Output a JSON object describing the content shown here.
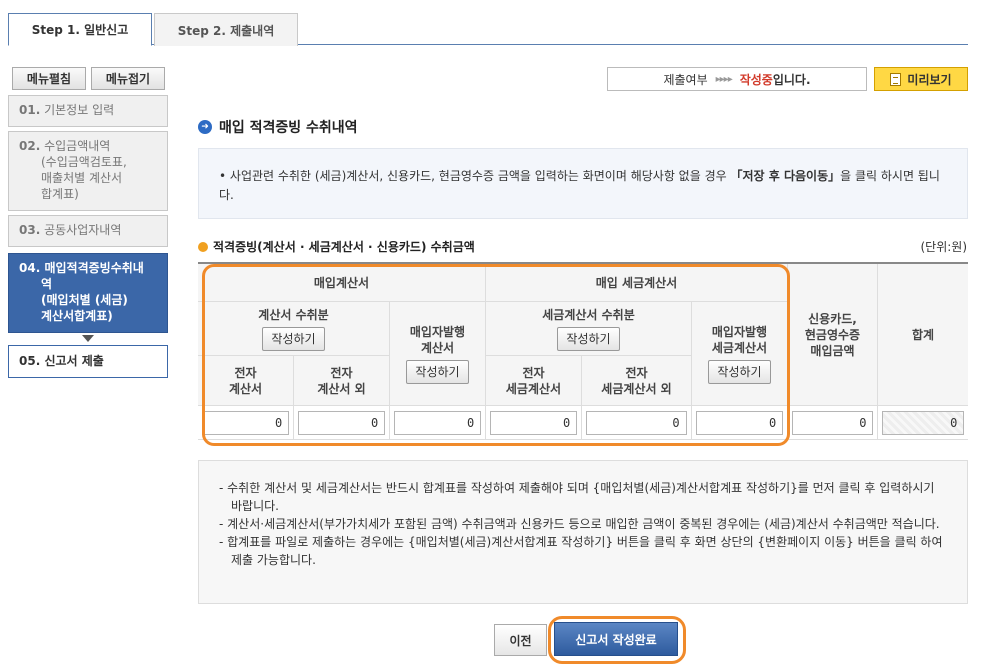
{
  "tabs": [
    {
      "label": "Step 1. 일반신고"
    },
    {
      "label": "Step 2. 제출내역"
    }
  ],
  "sidebar": {
    "expand_label": "메뉴펼침",
    "collapse_label": "메뉴접기",
    "items": [
      {
        "num": "01.",
        "label": "기본정보 입력"
      },
      {
        "num": "02.",
        "label": "수입금액내역",
        "sub": [
          "(수입금액검토표,",
          "매출처별 계산서",
          "합계표)"
        ]
      },
      {
        "num": "03.",
        "label": "공동사업자내역"
      },
      {
        "num": "04.",
        "label": "매입적격증빙수취내",
        "sub": [
          "역",
          "(매입처별 (세금)",
          "계산서합계표)"
        ]
      },
      {
        "num": "05.",
        "label": "신고서 제출"
      }
    ]
  },
  "status": {
    "label": "제출여부",
    "arrows": "▸▸▸▸",
    "state": "작성중",
    "suffix": "입니다."
  },
  "preview_label": "미리보기",
  "section_title": "매입 적격증빙 수취내역",
  "info": {
    "text_before": "사업관련 수취한 (세금)계산서, 신용카드, 현금영수증 금액을 입력하는 화면이며 해당사항 없을 경우",
    "highlight": "「저장 후 다음이동」",
    "text_after": "을 클릭 하시면 됩니다."
  },
  "sub_title": "적격증빙(계산서 · 세금계산서 · 신용카드) 수취금액",
  "unit": "(단위:원)",
  "table": {
    "group_purchase_invoice": "매입계산서",
    "group_purchase_tax_invoice": "매입 세금계산서",
    "received_invoice": "계산서 수취분",
    "buyer_issued_invoice": [
      "매입자발행",
      "계산서"
    ],
    "received_tax_invoice": "세금계산서 수취분",
    "buyer_issued_tax_invoice": [
      "매입자발행",
      "세금계산서"
    ],
    "card_cash": [
      "신용카드,",
      "현금영수증",
      "매입금액"
    ],
    "total": "합계",
    "electronic_invoice": [
      "전자",
      "계산서"
    ],
    "non_electronic_invoice": [
      "전자",
      "계산서 외"
    ],
    "electronic_tax_invoice": [
      "전자",
      "세금계산서"
    ],
    "non_electronic_tax_invoice": [
      "전자",
      "세금계산서 외"
    ],
    "write_button": "작성하기",
    "values": [
      "0",
      "0",
      "0",
      "0",
      "0",
      "0",
      "0",
      "0"
    ]
  },
  "notes": [
    "- 수취한 계산서 및 세금계산서는 반드시 합계표를 작성하여 제출해야 되며 {매입처별(세금)계산서합계표 작성하기}를 먼저 클릭 후 입력하시기 바랍니다.",
    "- 계산서·세금계산서(부가가치세가 포함된 금액) 수취금액과 신용카드 등으로 매입한 금액이 중복된 경우에는 (세금)계산서 수취금액만 적습니다.",
    "- 합계표를 파일로 제출하는 경우에는 {매입처별(세금)계산서합계표 작성하기} 버튼을 클릭 후 화면 상단의 {변환페이지 이동} 버튼을 클릭 하여 제출 가능합니다."
  ],
  "buttons": {
    "prev": "이전",
    "complete": "신고서 작성완료"
  },
  "colors": {
    "accent_blue": "#3b67a8",
    "highlight_orange": "#f08a2a",
    "status_red": "#d23a2a",
    "preview_yellow": "#ffd844"
  }
}
